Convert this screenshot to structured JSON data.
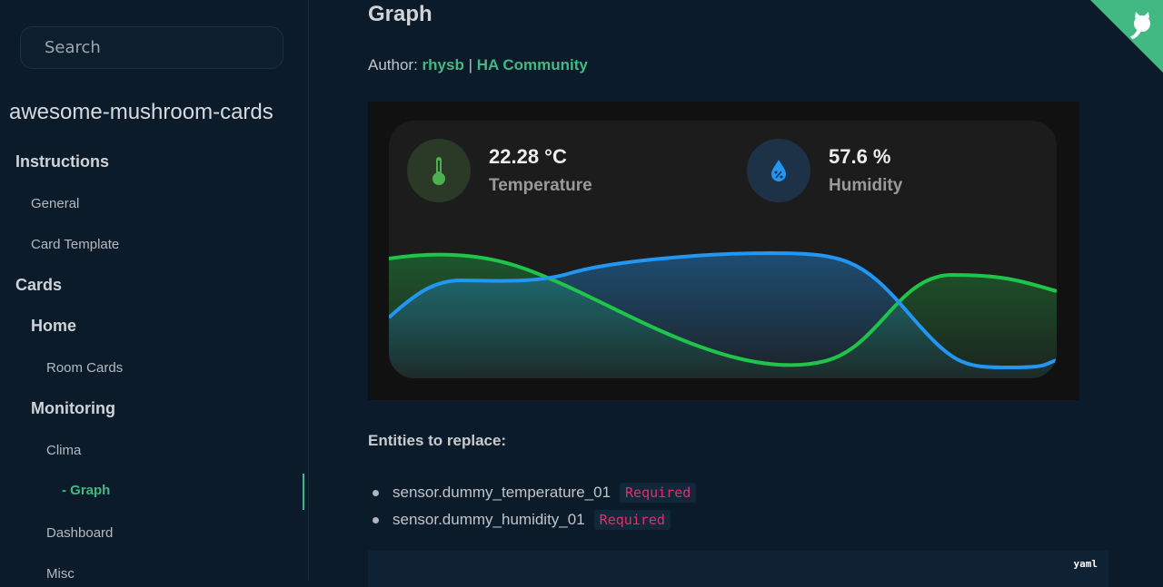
{
  "sidebar": {
    "search_placeholder": "Search",
    "repo_name": "awesome-mushroom-cards",
    "items": [
      {
        "label": "Instructions"
      },
      {
        "label": "General"
      },
      {
        "label": "Card Template"
      },
      {
        "label": "Cards"
      },
      {
        "label": "Home"
      },
      {
        "label": "Room Cards"
      },
      {
        "label": "Monitoring"
      },
      {
        "label": "Clima"
      },
      {
        "label": "- Graph"
      },
      {
        "label": "Dashboard"
      },
      {
        "label": "Misc"
      }
    ]
  },
  "page": {
    "title": "Graph",
    "author_label": "Author:",
    "author": "rhysb",
    "separator": "|",
    "community": "HA Community"
  },
  "card": {
    "temperature_value": "22.28 °C",
    "temperature_label": "Temperature",
    "humidity_value": "57.6 %",
    "humidity_label": "Humidity",
    "temp_color": "#1fc44a",
    "hum_color": "#2196f3"
  },
  "entities": {
    "heading": "Entities to replace:",
    "items": [
      {
        "name": "sensor.dummy_temperature_01",
        "badge": "Required"
      },
      {
        "name": "sensor.dummy_humidity_01",
        "badge": "Required"
      }
    ]
  },
  "code": {
    "lang": "yaml"
  },
  "accent": "#42b983"
}
